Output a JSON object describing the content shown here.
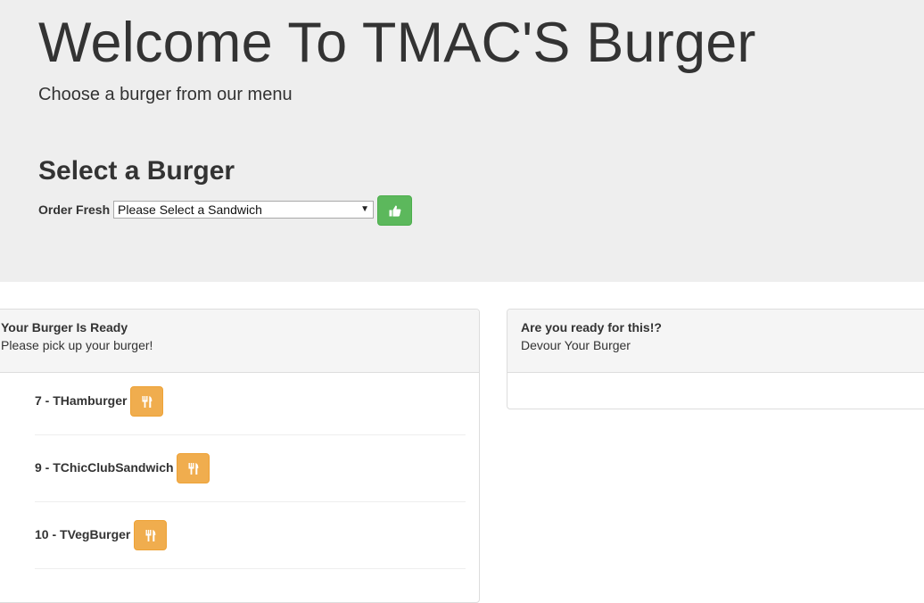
{
  "header": {
    "title": "Welcome To TMAC'S Burger",
    "subtitle": "Choose a burger from our menu"
  },
  "order": {
    "section_title": "Select a Burger",
    "label": "Order Fresh",
    "select_value": "Please Select a Sandwich",
    "submit_icon": "thumbs-up-icon",
    "submit_color": "#5cb85c"
  },
  "ready_panel": {
    "title": "Your Burger Is Ready",
    "subtitle": "Please pick up your burger!",
    "items": [
      {
        "label": "7 - THamburger",
        "icon": "cutlery-icon"
      },
      {
        "label": "9 - TChicClubSandwich",
        "icon": "cutlery-icon"
      },
      {
        "label": "10 - TVegBurger",
        "icon": "cutlery-icon"
      }
    ],
    "button_color": "#f0ad4e"
  },
  "devoured_panel": {
    "title": "Are you ready for this!?",
    "subtitle": "Devour Your Burger"
  }
}
